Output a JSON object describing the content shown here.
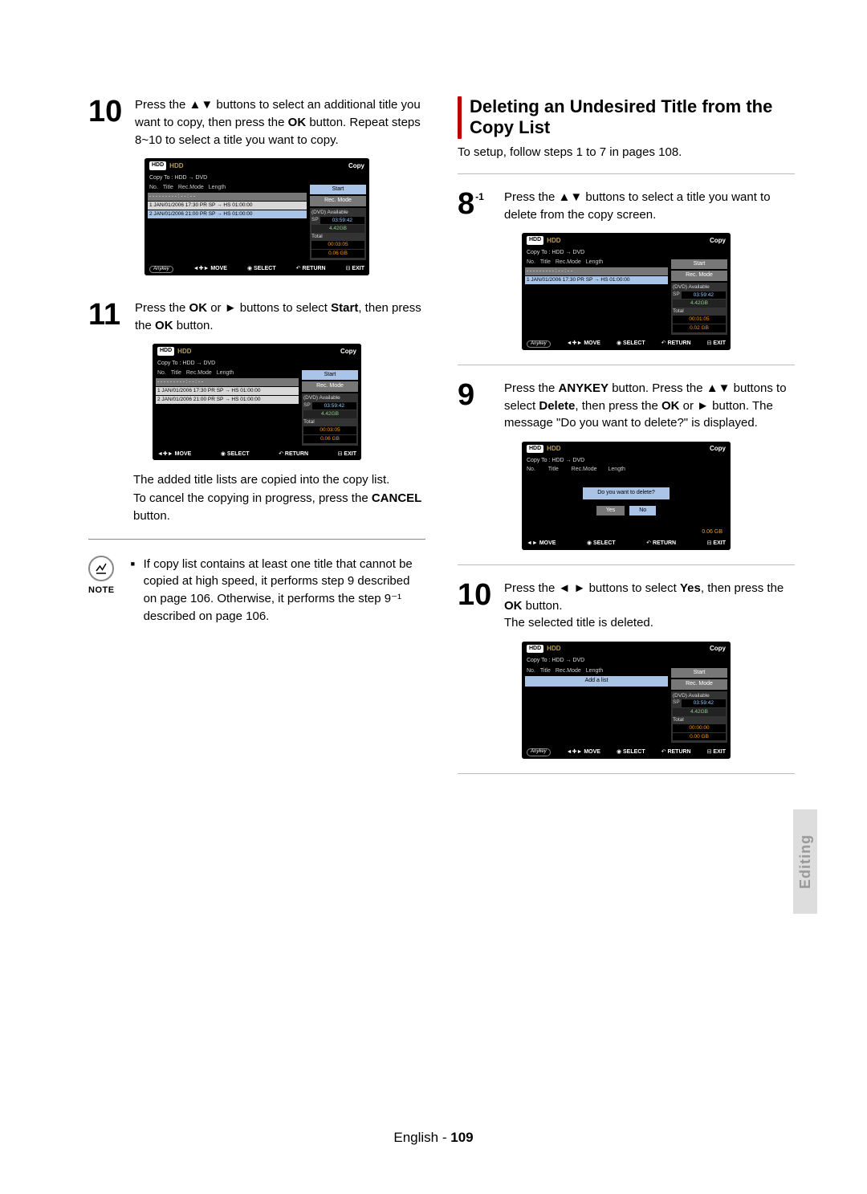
{
  "sideTab": "Editing",
  "footer": {
    "lang": "English",
    "sep": " - ",
    "page": "109"
  },
  "noteLabel": "NOTE",
  "leftCol": {
    "step10": {
      "num": "10",
      "text_a": "Press the ",
      "text_b": " buttons to select an additional title you want to copy, then press the ",
      "ok": "OK",
      "text_c": " button. Repeat steps 8~10 to select a title you want to copy."
    },
    "step11": {
      "num": "11",
      "text_a": "Press the ",
      "ok": "OK",
      "text_b": " or  ",
      "text_c": "  buttons to select ",
      "start": "Start",
      "text_d": ", then press the ",
      "text_e": " button."
    },
    "after11": {
      "l1": "The added title lists are copied into the copy list.",
      "l2a": "To cancel the copying in progress, press the ",
      "cancel": "CANCEL",
      "l2b": " button."
    },
    "note": "If copy list contains at least one title that cannot be copied at high speed, it performs step 9 described on page 106. Otherwise, it performs the step 9⁻¹ described on page 106."
  },
  "rightCol": {
    "title": "Deleting an Undesired Title from the Copy List",
    "setup": "To setup, follow steps 1 to 7 in pages 108.",
    "step8": {
      "num": "8",
      "sup": "-1",
      "text_a": "Press the ",
      "text_b": " buttons to select a title you want to delete from the copy screen."
    },
    "step9": {
      "num": "9",
      "text_a": "Press the ",
      "anykey": "ANYKEY",
      "text_b": " button. Press the ",
      "text_c": " buttons to select ",
      "del": "Delete",
      "text_d": ", then press the ",
      "ok": "OK",
      "text_e": " or  ",
      "text_f": "  button. The message \"Do you want to delete?\" is displayed."
    },
    "step10": {
      "num": "10",
      "text_a": "Press the ",
      "text_b": " buttons to select ",
      "yes": "Yes",
      "text_c": ", then press the ",
      "ok": "OK",
      "text_d": " button.",
      "l2": "The selected title is deleted."
    }
  },
  "osd": {
    "hddChip": "HDD",
    "hddLabel": "HDD",
    "copy": "Copy",
    "copyTo": "Copy To : HDD  →  DVD",
    "cols": {
      "no": "No.",
      "title": "Title",
      "rec": "Rec.Mode",
      "len": "Length"
    },
    "dash": "-  - - - -           - -    - - : - - : - -",
    "row1": "1   JAN/01/2006 17:30 PR   SP → HS   01:00:00",
    "row2": "2   JAN/01/2006 21:00 PR   SP → HS   01:00:00",
    "btnStart": "Start",
    "btnRecMode": "Rec. Mode",
    "dvdAvail": "(DVD) Available",
    "sp": "SP",
    "t1": "03:59:42",
    "gb1": "4.42GB",
    "totLbl": "Total",
    "t10a": "00:03:05",
    "gb10a": "0.06 GB",
    "t8": "00:01:05",
    "gb8": "0.02 GB",
    "t10c": "00:00:00",
    "gb10c": "0.00 GB",
    "botAny": "Anykey",
    "botMove": "MOVE",
    "botSelect": "SELECT",
    "botReturn": "RETURN",
    "botExit": "EXIT",
    "dialogQ": "Do you want to delete?",
    "yes": "Yes",
    "no": "No",
    "addList": "Add a list"
  }
}
